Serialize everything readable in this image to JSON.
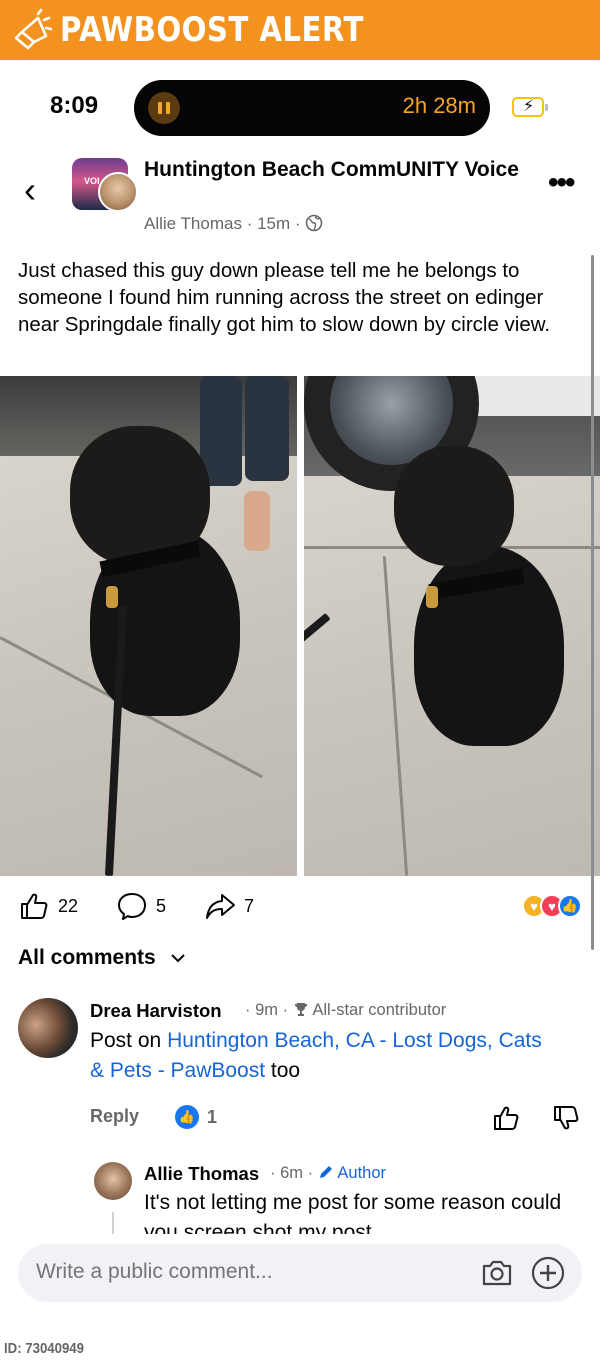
{
  "banner": {
    "title": "PAWBOOST ALERT",
    "icon": "megaphone-icon"
  },
  "status_bar": {
    "time": "8:09",
    "activity_timer": "2h 28m",
    "icons": [
      "pause-icon",
      "battery-charging-icon"
    ]
  },
  "post": {
    "group_name": "Huntington Beach CommUNITY Voice",
    "author": "Allie Thomas",
    "time_ago": "15m",
    "separator": "·",
    "privacy_icon": "globe-icon",
    "text": "Just chased this guy down please tell me he belongs to someone I found him running across the street on edinger near Springdale finally got him to slow down by circle view.",
    "photos": [
      "dog-photo-front",
      "dog-photo-side"
    ]
  },
  "actions": {
    "likes": "22",
    "comments": "5",
    "shares": "7",
    "reactions": [
      "care-reaction",
      "love-reaction",
      "like-reaction"
    ]
  },
  "comments_header": {
    "label": "All comments",
    "icon": "chevron-down-icon"
  },
  "comments": [
    {
      "name": "Drea Harviston",
      "time": "9m",
      "badge": "All-star contributor",
      "text_prefix": "Post on ",
      "link_text": "Huntington Beach, CA - Lost Dogs, Cats & Pets - PawBoost",
      "text_suffix": " too",
      "reply_label": "Reply",
      "like_count": "1"
    },
    {
      "name": "Allie Thomas",
      "time": "6m",
      "badge": "Author",
      "text": "It's not letting me post for some reason could you screen shot my post"
    }
  ],
  "composer": {
    "placeholder": "Write a public comment..."
  },
  "footer": {
    "id_label": "ID: 73040949"
  },
  "colors": {
    "brand_orange": "#f4921f",
    "link_blue": "#1565d8",
    "like_blue": "#1877f2"
  }
}
